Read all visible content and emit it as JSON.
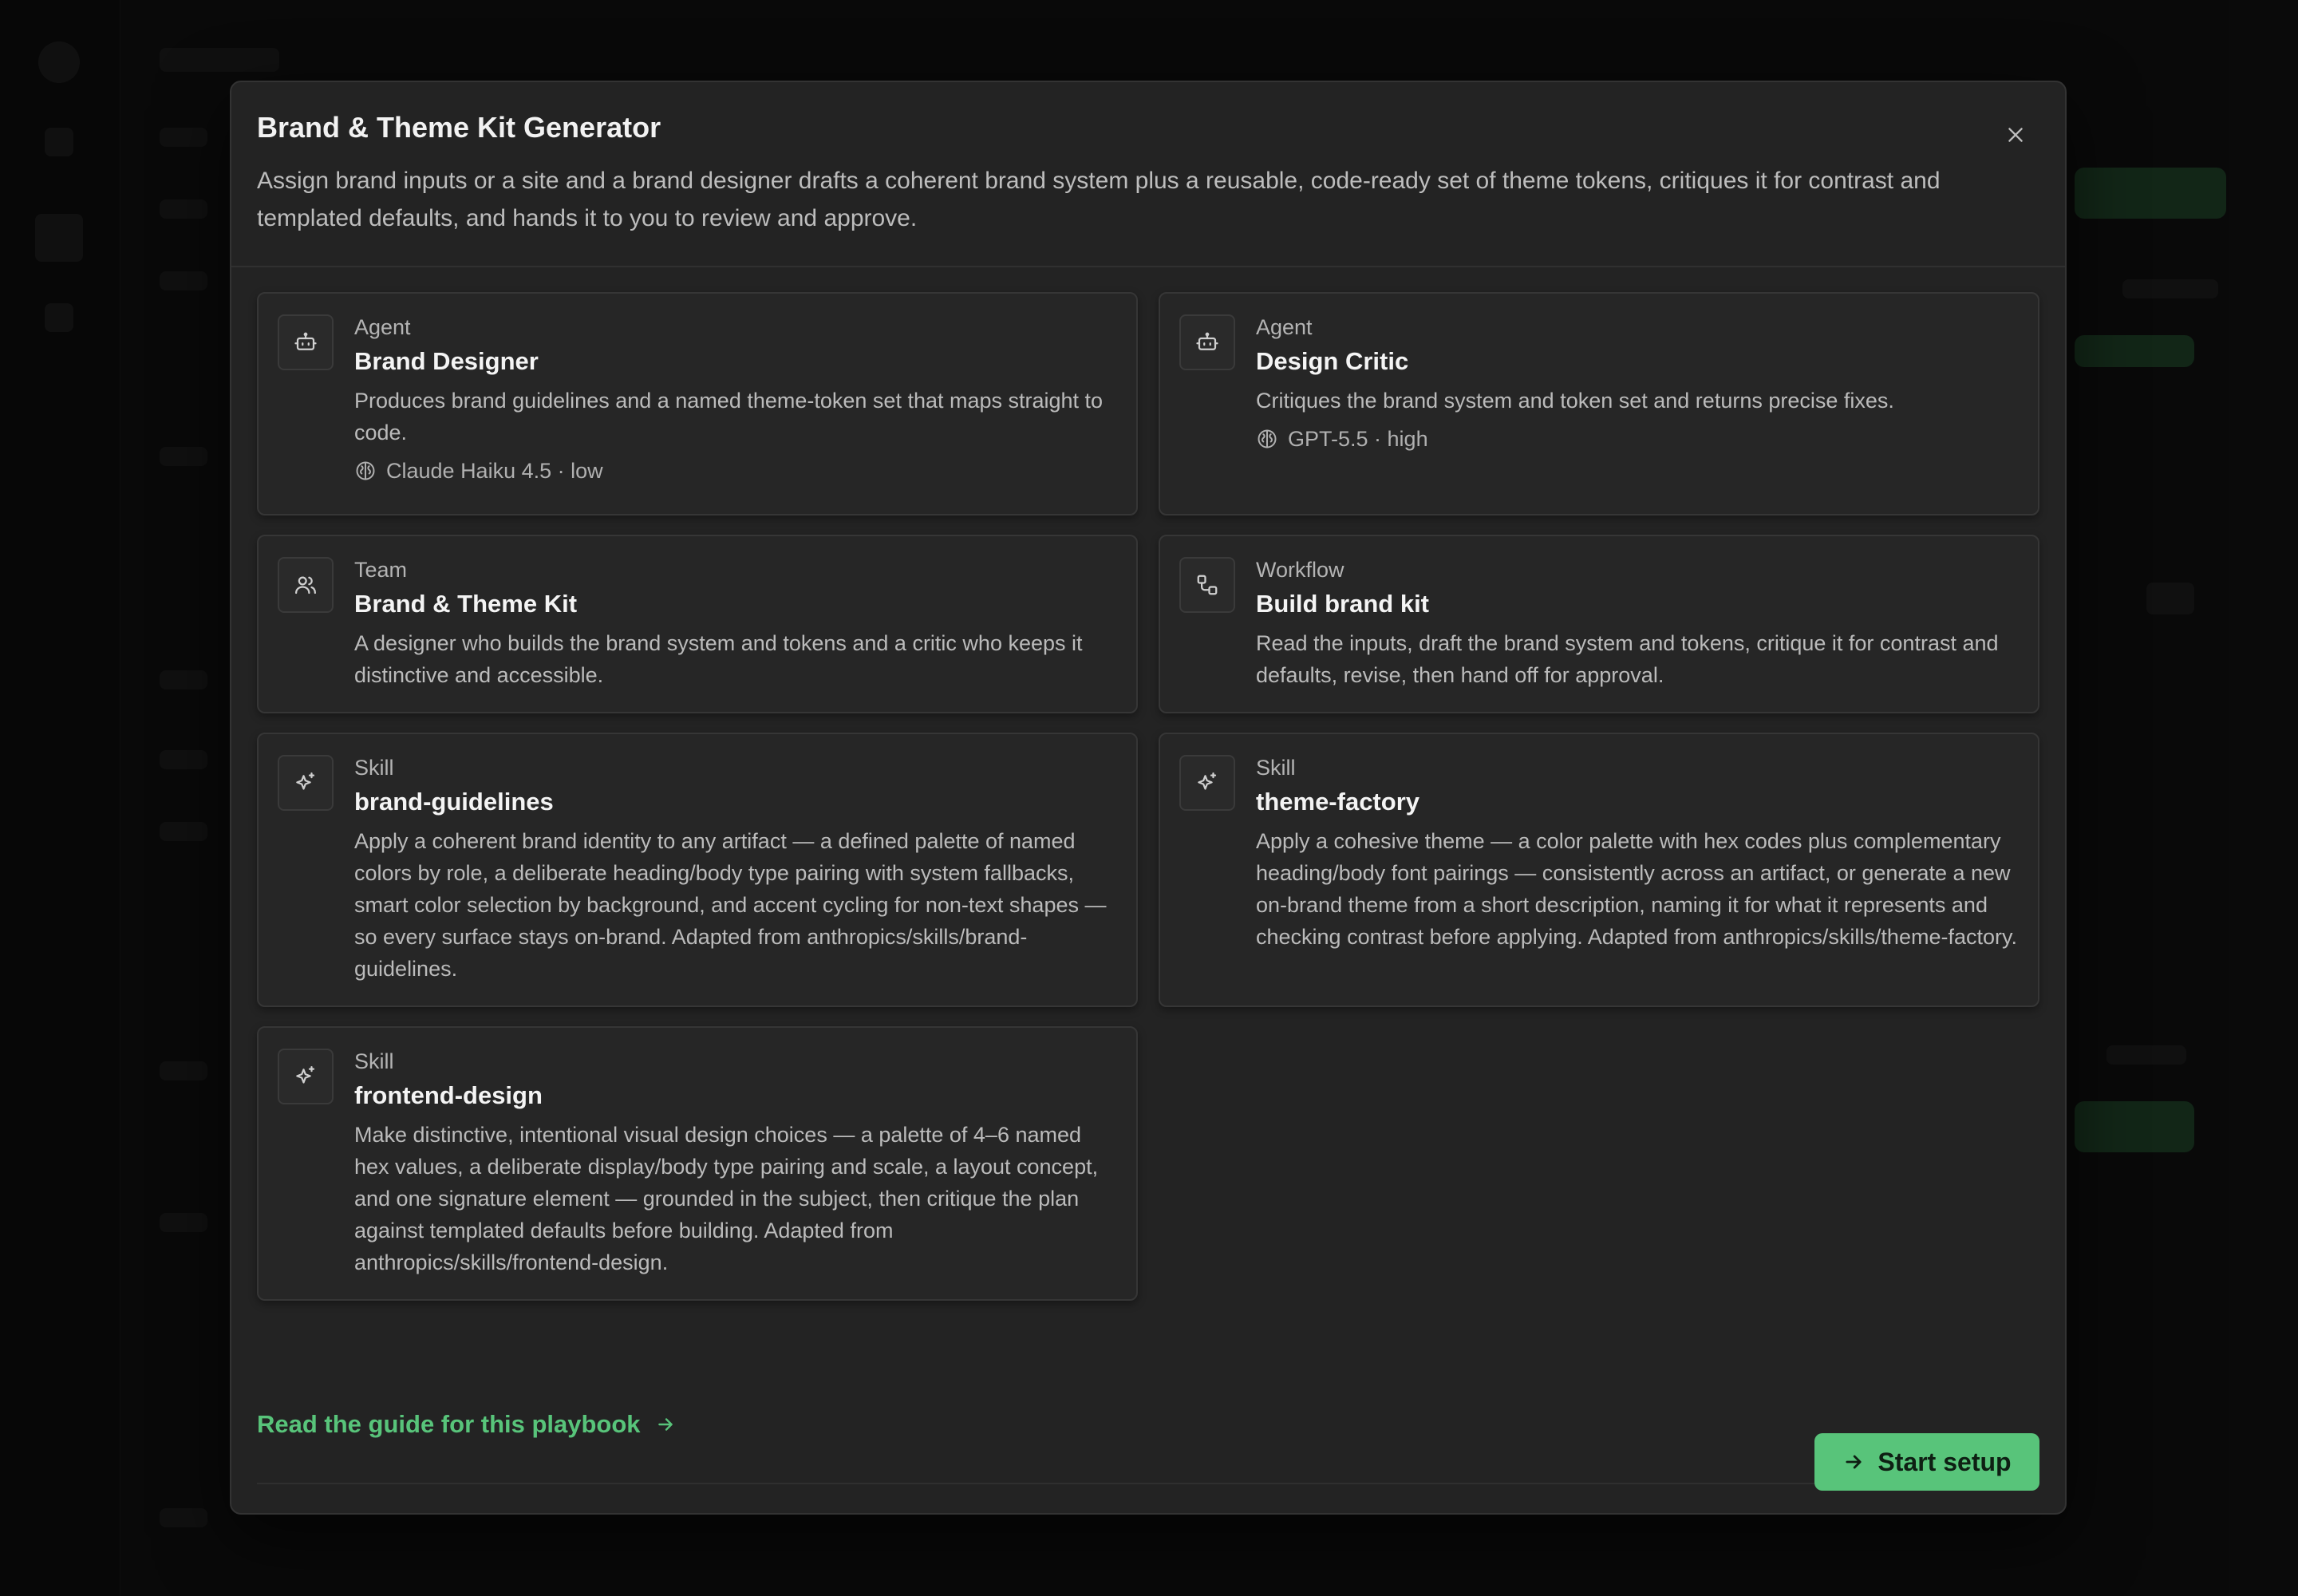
{
  "modal": {
    "title": "Brand & Theme Kit Generator",
    "description": "Assign brand inputs or a site and a brand designer drafts a coherent brand system plus a reusable, code-ready set of theme tokens, critiques it for contrast and templated defaults, and hands it to you to review and approve."
  },
  "cards": [
    {
      "kind": "Agent",
      "name": "Brand Designer",
      "description": "Produces brand guidelines and a named theme-token set that maps straight to code.",
      "model": "Claude Haiku 4.5 · low",
      "icon": "robot-icon"
    },
    {
      "kind": "Agent",
      "name": "Design Critic",
      "description": "Critiques the brand system and token set and returns precise fixes.",
      "model": "GPT-5.5 · high",
      "icon": "robot-icon"
    },
    {
      "kind": "Team",
      "name": "Brand & Theme Kit",
      "description": "A designer who builds the brand system and tokens and a critic who keeps it distinctive and accessible.",
      "icon": "users-icon"
    },
    {
      "kind": "Workflow",
      "name": "Build brand kit",
      "description": "Read the inputs, draft the brand system and tokens, critique it for contrast and defaults, revise, then hand off for approval.",
      "icon": "workflow-icon"
    },
    {
      "kind": "Skill",
      "name": "brand-guidelines",
      "description": "Apply a coherent brand identity to any artifact — a defined palette of named colors by role, a deliberate heading/body type pairing with system fallbacks, smart color selection by background, and accent cycling for non-text shapes — so every surface stays on-brand. Adapted from anthropics/skills/brand-guidelines.",
      "icon": "sparkles-icon"
    },
    {
      "kind": "Skill",
      "name": "theme-factory",
      "description": "Apply a cohesive theme — a color palette with hex codes plus complementary heading/body font pairings — consistently across an artifact, or generate a new on-brand theme from a short description, naming it for what it represents and checking contrast before applying. Adapted from anthropics/skills/theme-factory.",
      "icon": "sparkles-icon"
    },
    {
      "kind": "Skill",
      "name": "frontend-design",
      "description": "Make distinctive, intentional visual design choices — a palette of 4–6 named hex values, a deliberate display/body type pairing and scale, a layout concept, and one signature element — grounded in the subject, then critique the plan against templated defaults before building. Adapted from anthropics/skills/frontend-design.",
      "icon": "sparkles-icon"
    }
  ],
  "guide_link": "Read the guide for this playbook",
  "start_button": "Start setup",
  "colors": {
    "accent": "#58c47a",
    "modal_bg": "#232323",
    "card_bg": "#262626"
  }
}
